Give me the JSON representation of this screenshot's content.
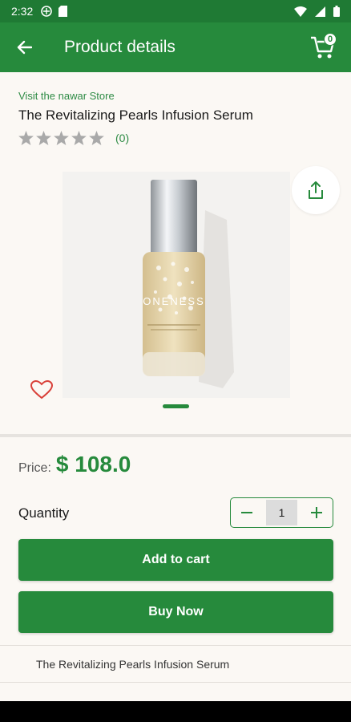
{
  "status_bar": {
    "time": "2:32"
  },
  "app_bar": {
    "title": "Product details",
    "cart_count": "0"
  },
  "product": {
    "store_link": "Visit the nawar Store",
    "name": "The Revitalizing Pearls Infusion Serum",
    "rating": 0,
    "review_count": "(0)",
    "image_brand_text": "ONENESS",
    "price_label": "Price:",
    "price": "$ 108.0"
  },
  "quantity": {
    "label": "Quantity",
    "value": "1"
  },
  "actions": {
    "add_to_cart": "Add to cart",
    "buy_now": "Buy Now"
  },
  "description": {
    "title": "The Revitalizing Pearls Infusion Serum"
  },
  "colors": {
    "primary": "#268a3c",
    "background": "#fbf8f4",
    "heart": "#d9413a"
  }
}
